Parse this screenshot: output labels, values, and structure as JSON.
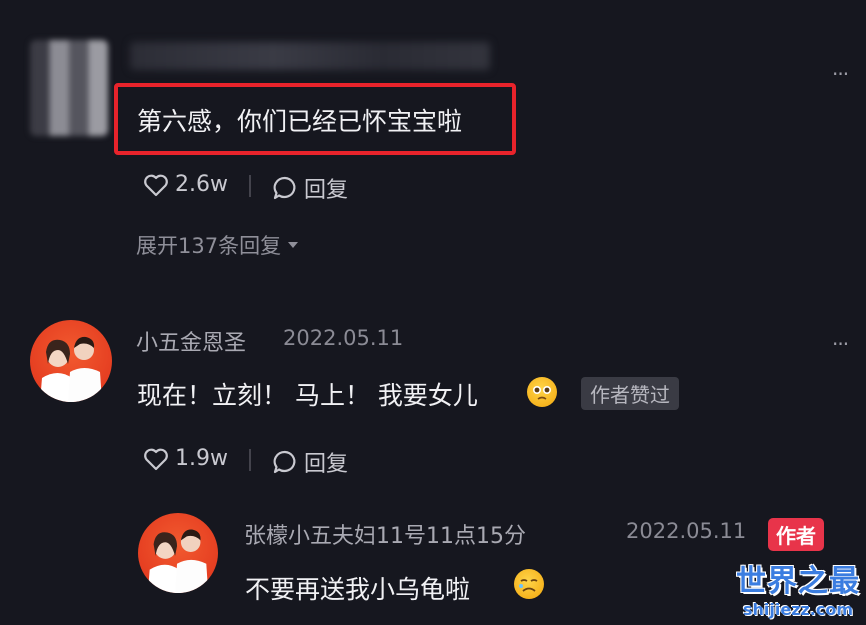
{
  "comment_top": {
    "text": "第六感，你们已经已怀宝宝啦",
    "likes": "2.6w",
    "reply_label": "回复",
    "expand_label": "展开137条回复"
  },
  "comment_main": {
    "username": "小五金恩圣",
    "date": "2022.05.11",
    "text": "现在！立刻！ 马上！ 我要女儿",
    "author_liked": "作者赞过",
    "likes": "1.9w",
    "reply_label": "回复"
  },
  "reply": {
    "username": "张檬小五夫妇11号11点15分",
    "date": "2022.05.11",
    "badge": "作者",
    "text": "不要再送我小乌龟啦"
  },
  "watermark": {
    "title": "世界之最",
    "sub": "shijiezz.com"
  },
  "colors": {
    "background": "#16171f",
    "highlight": "#e8232b",
    "author_badge": "#e8344a",
    "watermark": "#3b7de0"
  },
  "icons": [
    "more-dots-icon",
    "heart-icon",
    "chat-bubble-icon",
    "caret-down-icon",
    "pleading-face-emoji",
    "crying-face-emoji"
  ]
}
